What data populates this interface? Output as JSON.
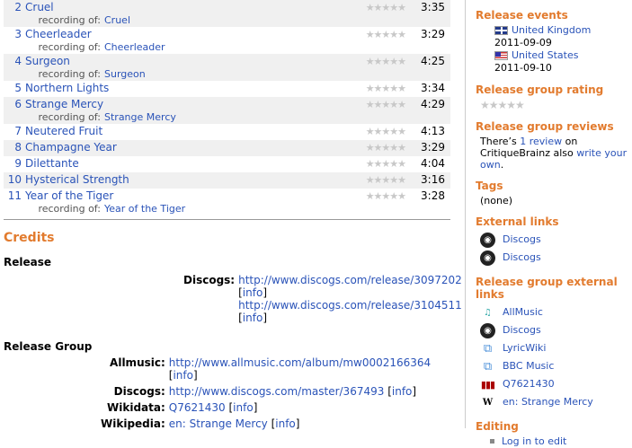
{
  "tracks": [
    {
      "num": "2",
      "title": "Cruel",
      "length": "3:35",
      "recording": "Cruel"
    },
    {
      "num": "3",
      "title": "Cheerleader",
      "length": "3:29",
      "recording": "Cheerleader"
    },
    {
      "num": "4",
      "title": "Surgeon",
      "length": "4:25",
      "recording": "Surgeon"
    },
    {
      "num": "5",
      "title": "Northern Lights",
      "length": "3:34",
      "recording": null
    },
    {
      "num": "6",
      "title": "Strange Mercy",
      "length": "4:29",
      "recording": "Strange Mercy"
    },
    {
      "num": "7",
      "title": "Neutered Fruit",
      "length": "4:13",
      "recording": null
    },
    {
      "num": "8",
      "title": "Champagne Year",
      "length": "3:29",
      "recording": null
    },
    {
      "num": "9",
      "title": "Dilettante",
      "length": "4:04",
      "recording": null
    },
    {
      "num": "10",
      "title": "Hysterical Strength",
      "length": "3:16",
      "recording": null
    },
    {
      "num": "11",
      "title": "Year of the Tiger",
      "length": "3:28",
      "recording": "Year of the Tiger"
    }
  ],
  "recording_label": "recording of:",
  "stars": "★★★★★",
  "credits": {
    "title": "Credits",
    "release_heading": "Release",
    "discogs_label": "Discogs:",
    "release_links": [
      "http://www.discogs.com/release/3097202",
      "http://www.discogs.com/release/3104511"
    ],
    "info": "info",
    "group_heading": "Release Group",
    "group_rows": [
      {
        "label": "Allmusic:",
        "link": "http://www.allmusic.com/album/mw0002166364"
      },
      {
        "label": "Discogs:",
        "link": "http://www.discogs.com/master/367493"
      },
      {
        "label": "Wikidata:",
        "link": "Q7621430"
      },
      {
        "label": "Wikipedia:",
        "link": "en: Strange Mercy"
      }
    ]
  },
  "sidebar": {
    "events_title": "Release events",
    "events": [
      {
        "country": "United Kingdom",
        "date": "2011-09-09",
        "flag": "gb"
      },
      {
        "country": "United States",
        "date": "2011-09-10",
        "flag": "us"
      }
    ],
    "rating_title": "Release group rating",
    "reviews_title": "Release group reviews",
    "reviews_pre": "There’s ",
    "reviews_link": "1 review",
    "reviews_mid": " on CritiqueBrainz also ",
    "reviews_write": "write your own",
    "reviews_end": ".",
    "tags_title": "Tags",
    "tags_none": "(none)",
    "ext_title": "External links",
    "ext_links": [
      "Discogs",
      "Discogs"
    ],
    "rg_ext_title": "Release group external links",
    "rg_ext_links": [
      {
        "label": "AllMusic",
        "icon": "allmusic-icon"
      },
      {
        "label": "Discogs",
        "icon": "discogs-icon"
      },
      {
        "label": "LyricWiki",
        "icon": "lyricwiki-icon"
      },
      {
        "label": "BBC Music",
        "icon": "bbc-music-icon"
      },
      {
        "label": "Q7621430",
        "icon": "wikidata-icon"
      },
      {
        "label": "en: Strange Mercy",
        "icon": "wikipedia-icon"
      }
    ],
    "editing_title": "Editing",
    "editing_link": "Log in to edit"
  },
  "colors": {
    "link": "#2a53b8",
    "heading": "#e27b2e",
    "row_alt": "#f0f0f0"
  }
}
